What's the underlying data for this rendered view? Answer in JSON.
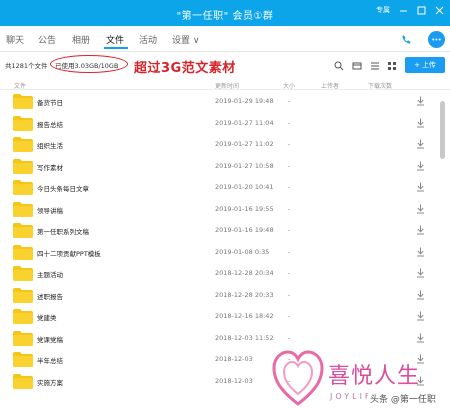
{
  "window": {
    "title": "\"第一任职\" 会员①群",
    "right_label": "专属"
  },
  "tabs": [
    {
      "label": "聊天"
    },
    {
      "label": "公告"
    },
    {
      "label": "相册"
    },
    {
      "label": "文件"
    },
    {
      "label": "活动"
    },
    {
      "label": "设置 ∨"
    }
  ],
  "toolbar": {
    "file_count": "共1281个文件",
    "usage": "已使用3.03GB/10GB",
    "promo": "超过3G范文素材",
    "upload_label": "上传"
  },
  "columns": {
    "name": "文件",
    "time": "更新时间",
    "size": "大小",
    "uploader": "上传者",
    "downloads": "下载次数"
  },
  "files": [
    {
      "name": "备货节日",
      "time": "2019-01-29 19:48"
    },
    {
      "name": "报告总结",
      "time": "2019-01-27 11:04"
    },
    {
      "name": "组织生活",
      "time": "2019-01-27 11:02"
    },
    {
      "name": "写作素材",
      "time": "2019-01-27 10:58"
    },
    {
      "name": "今日头条每日文章",
      "time": "2019-01-20 10:41"
    },
    {
      "name": "领导讲稿",
      "time": "2019-01-16 19:55"
    },
    {
      "name": "第一任职系列文稿",
      "time": "2019-01-16 19:48"
    },
    {
      "name": "四十二项贡献PPT模板",
      "time": "2019-01-08 0:35"
    },
    {
      "name": "主题活动",
      "time": "2018-12-28 20:34"
    },
    {
      "name": "述职报告",
      "time": "2018-12-28 20:33"
    },
    {
      "name": "党建类",
      "time": "2018-12-16 18:42"
    },
    {
      "name": "党课党稿",
      "time": "2018-12-03 11:52"
    },
    {
      "name": "半年总结",
      "time": "2018-12-03"
    },
    {
      "name": "实施方案",
      "time": "2018-12-03"
    }
  ],
  "watermark": {
    "brand": "喜悦人生",
    "sub": "JOYLIFE",
    "credit": "头条 @第一任职"
  },
  "colors": {
    "titlebar": "#0da5ea",
    "folder": "#f5c518",
    "highlight": "#d8232a",
    "upload": "#1a9df0"
  }
}
